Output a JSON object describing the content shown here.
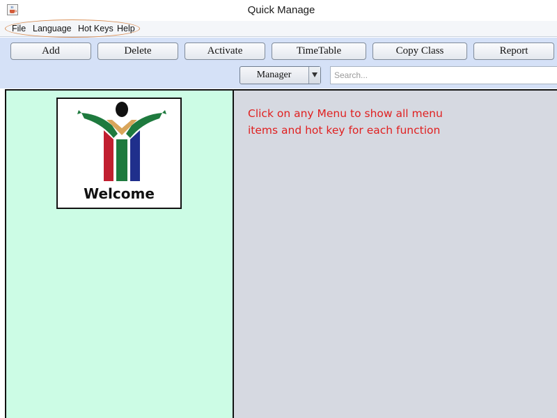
{
  "window": {
    "title": "Quick Manage",
    "app_icon": "java-cup-icon"
  },
  "menubar": {
    "items": [
      {
        "label": "File"
      },
      {
        "label": "Language"
      },
      {
        "label": "Hot Keys"
      },
      {
        "label": "Help"
      }
    ],
    "highlight_color": "#d98e55"
  },
  "toolbar": {
    "buttons": [
      {
        "label": "Add"
      },
      {
        "label": "Delete"
      },
      {
        "label": "Activate"
      },
      {
        "label": "TimeTable"
      },
      {
        "label": "Copy Class"
      },
      {
        "label": "Report"
      }
    ],
    "role_select": {
      "value": "Manager",
      "icon": "dropdown-arrow-icon"
    },
    "search": {
      "value": "",
      "placeholder": "Search..."
    }
  },
  "left_panel": {
    "welcome_label": "Welcome",
    "logo": "welcome-person-logo",
    "background": "#ccfce5"
  },
  "right_panel": {
    "hint_line1": "Click on any Menu to show all menu",
    "hint_line2": "items and hot key for each function",
    "hint_color": "#e02020",
    "background": "#d6d9e1"
  },
  "colors": {
    "toolbar_bg": "#d5e1f7",
    "menubar_bg": "#f4f6f9"
  }
}
